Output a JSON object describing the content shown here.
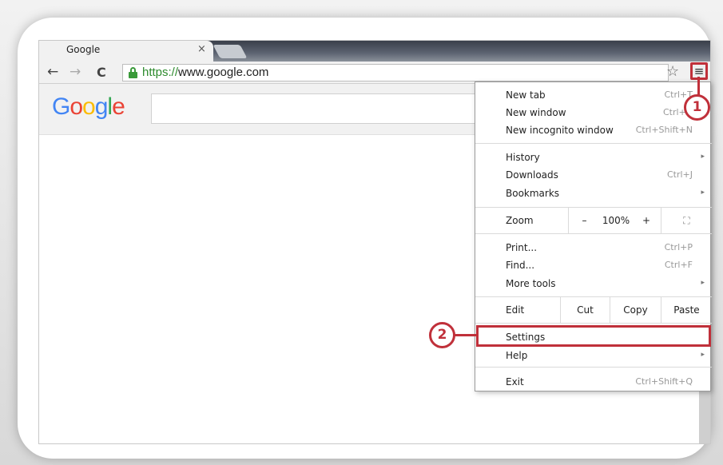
{
  "tab": {
    "title": "Google",
    "close": "×"
  },
  "toolbar": {
    "back": "←",
    "forward": "→",
    "reload": "C",
    "url_scheme": "https://",
    "url_rest": "www.google.com",
    "bookmark": "☆",
    "menu": "≡"
  },
  "google": {
    "logo_letters": [
      {
        "ch": "G",
        "color": "#4285f4"
      },
      {
        "ch": "o",
        "color": "#ea4335"
      },
      {
        "ch": "o",
        "color": "#fbbc05"
      },
      {
        "ch": "g",
        "color": "#4285f4"
      },
      {
        "ch": "l",
        "color": "#34a853"
      },
      {
        "ch": "e",
        "color": "#ea4335"
      }
    ]
  },
  "menu": {
    "new_tab": {
      "label": "New tab",
      "shortcut": "Ctrl+T"
    },
    "new_window": {
      "label": "New window",
      "shortcut": "Ctrl+N"
    },
    "new_incognito": {
      "label": "New incognito window",
      "shortcut": "Ctrl+Shift+N"
    },
    "history": {
      "label": "History"
    },
    "downloads": {
      "label": "Downloads",
      "shortcut": "Ctrl+J"
    },
    "bookmarks": {
      "label": "Bookmarks"
    },
    "zoom": {
      "label": "Zoom",
      "minus": "–",
      "value": "100%",
      "plus": "+",
      "fullscreen": "⛶"
    },
    "print": {
      "label": "Print...",
      "shortcut": "Ctrl+P"
    },
    "find": {
      "label": "Find...",
      "shortcut": "Ctrl+F"
    },
    "more_tools": {
      "label": "More tools"
    },
    "edit": {
      "label": "Edit",
      "cut": "Cut",
      "copy": "Copy",
      "paste": "Paste"
    },
    "settings": {
      "label": "Settings"
    },
    "help": {
      "label": "Help"
    },
    "exit": {
      "label": "Exit",
      "shortcut": "Ctrl+Shift+Q"
    },
    "submenu_arrow": "▸"
  },
  "callouts": {
    "one": "1",
    "two": "2"
  },
  "colors": {
    "accent": "#c0303a",
    "url_green": "#2e8b2e"
  }
}
